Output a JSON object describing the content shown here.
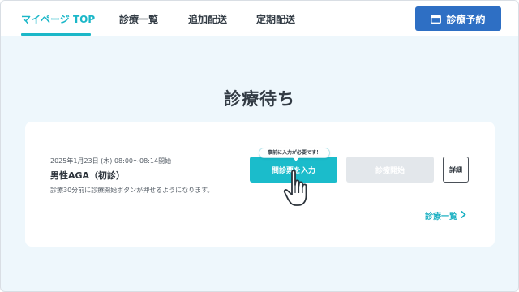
{
  "header": {
    "tabs": [
      {
        "label": "マイページ TOP",
        "active": true
      },
      {
        "label": "診療一覧",
        "active": false
      },
      {
        "label": "追加配送",
        "active": false
      },
      {
        "label": "定期配送",
        "active": false
      }
    ],
    "reserve_button": {
      "label": "診療予約",
      "icon": "calendar-icon"
    }
  },
  "main": {
    "section_title": "診療待ち",
    "appointment": {
      "datetime": "2025年1月23日 (木) 08:00〜08:14開始",
      "name": "男性AGA（初診）",
      "note": "診療30分前に診療開始ボタンが押せるようになります。",
      "tooltip": "事前に入力が必要です！",
      "questionnaire_button": "問診票を入力",
      "start_button": "診療開始",
      "detail_button": "詳細"
    },
    "list_link": {
      "label": "診療一覧",
      "icon": "chevron-right-icon"
    }
  },
  "colors": {
    "accent": "#1bb7c8",
    "primary_button": "#2e6fc4",
    "page_background": "#eef7fc",
    "disabled_button": "#e3e7eb"
  }
}
